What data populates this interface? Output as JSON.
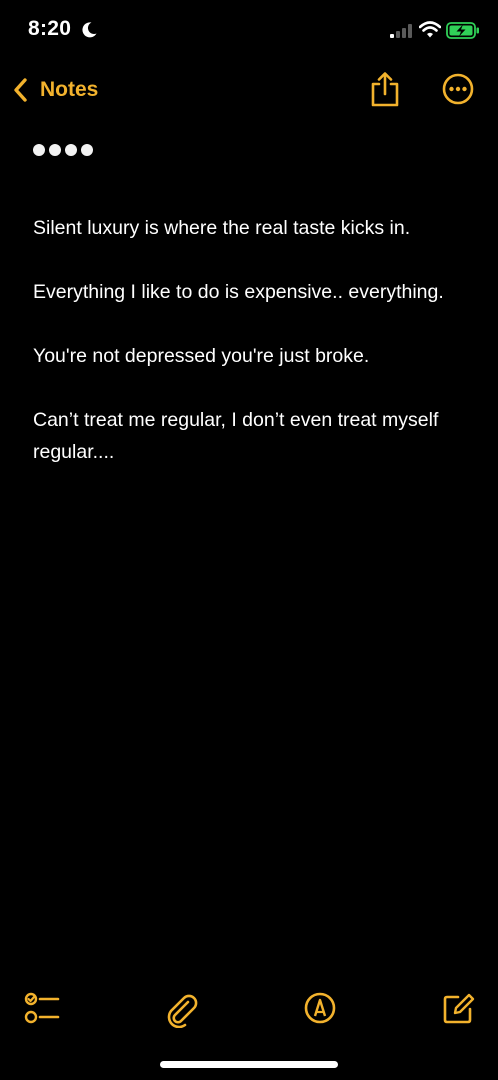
{
  "status_bar": {
    "time": "8:20",
    "icons": [
      "moon-icon",
      "cellular-signal-icon",
      "wifi-icon",
      "battery-charging-icon"
    ],
    "battery_color": "#30D158"
  },
  "nav": {
    "back_label": "Notes",
    "icons": [
      "chevron-left-icon",
      "share-icon",
      "more-icon"
    ],
    "accent_color": "#F2B22D"
  },
  "note": {
    "title_masked": "●●●●",
    "paragraphs": [
      "Silent luxury is where the real taste kicks in.",
      "Everything I like to do is expensive.. everything.",
      "You're not depressed you're just broke.",
      "Can’t treat me regular, I don’t even treat myself regular...."
    ]
  },
  "toolbar": {
    "icons": [
      "checklist-icon",
      "paperclip-icon",
      "markup-pen-icon",
      "compose-icon"
    ]
  }
}
